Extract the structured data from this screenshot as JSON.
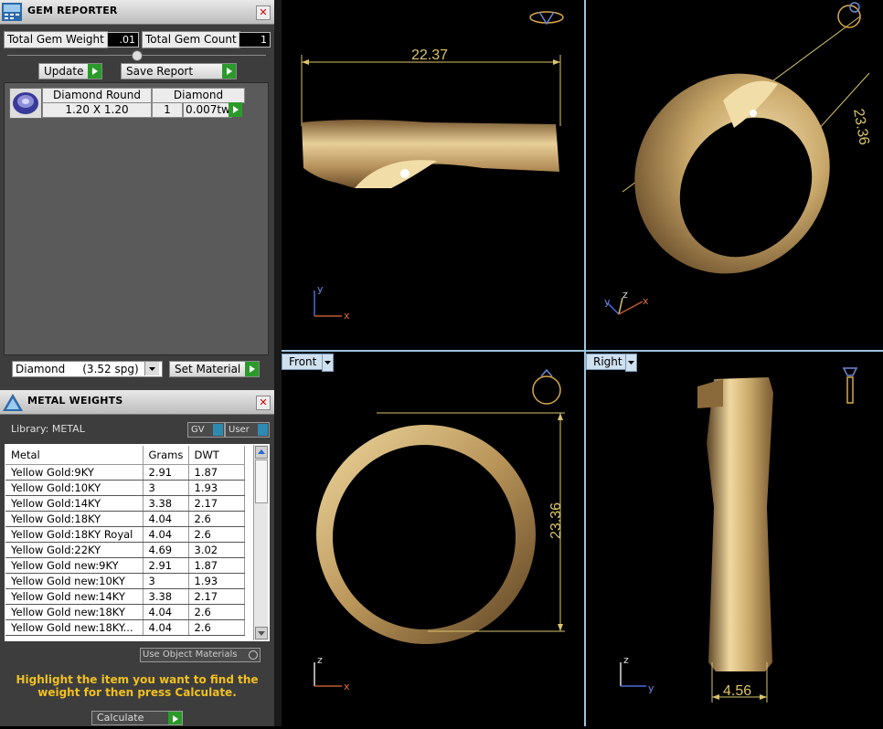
{
  "gem_reporter": {
    "title": "GEM REPORTER",
    "total_weight_label": "Total Gem Weight",
    "total_weight_value": ".01",
    "total_count_label": "Total Gem Count",
    "total_count_value": "1",
    "update_label": "Update",
    "save_report_label": "Save Report",
    "gem_row": {
      "shape": "Diamond Round",
      "type": "Diamond",
      "size": "1.20 X 1.20",
      "count": "1",
      "weight": "0.007tw"
    },
    "material_select": "Diamond     (3.52 spg)",
    "set_material_label": "Set Material"
  },
  "metal_weights": {
    "title": "METAL WEIGHTS",
    "library_label": "Library: METAL",
    "gv_label": "GV",
    "user_label": "User",
    "columns": [
      "Metal",
      "Grams",
      "DWT"
    ],
    "rows": [
      [
        "Yellow Gold:9KY",
        "2.91",
        "1.87"
      ],
      [
        "Yellow Gold:10KY",
        "3",
        "1.93"
      ],
      [
        "Yellow Gold:14KY",
        "3.38",
        "2.17"
      ],
      [
        "Yellow Gold:18KY",
        "4.04",
        "2.6"
      ],
      [
        "Yellow Gold:18KY Royal",
        "4.04",
        "2.6"
      ],
      [
        "Yellow Gold:22KY",
        "4.69",
        "3.02"
      ],
      [
        "Yellow Gold new:9KY",
        "2.91",
        "1.87"
      ],
      [
        "Yellow Gold new:10KY",
        "3",
        "1.93"
      ],
      [
        "Yellow Gold new:14KY",
        "3.38",
        "2.17"
      ],
      [
        "Yellow Gold new:18KY",
        "4.04",
        "2.6"
      ],
      [
        "Yellow Gold new:18KY...",
        "4.04",
        "2.6"
      ]
    ],
    "use_object_materials_label": "Use Object Materials",
    "hint": "Highlight the item you want to find the weight for then press Calculate.",
    "calculate_label": "Calculate"
  },
  "viewports": {
    "top": {
      "dimension": "22.37",
      "axis1": "y",
      "axis2": "x"
    },
    "perspective": {
      "dimension": "23.36",
      "axis1": "y",
      "axis2": "z",
      "axis3": "x"
    },
    "front": {
      "label": "Front",
      "dimension": "23.36",
      "axis1": "z",
      "axis2": "x"
    },
    "right": {
      "label": "Right",
      "dimension": "4.56",
      "axis1": "z",
      "axis2": "y"
    }
  },
  "colors": {
    "gold": "#c9a86a",
    "dimension": "#d9c46a",
    "hint": "#f0c020",
    "divider": "#9ec3de"
  }
}
